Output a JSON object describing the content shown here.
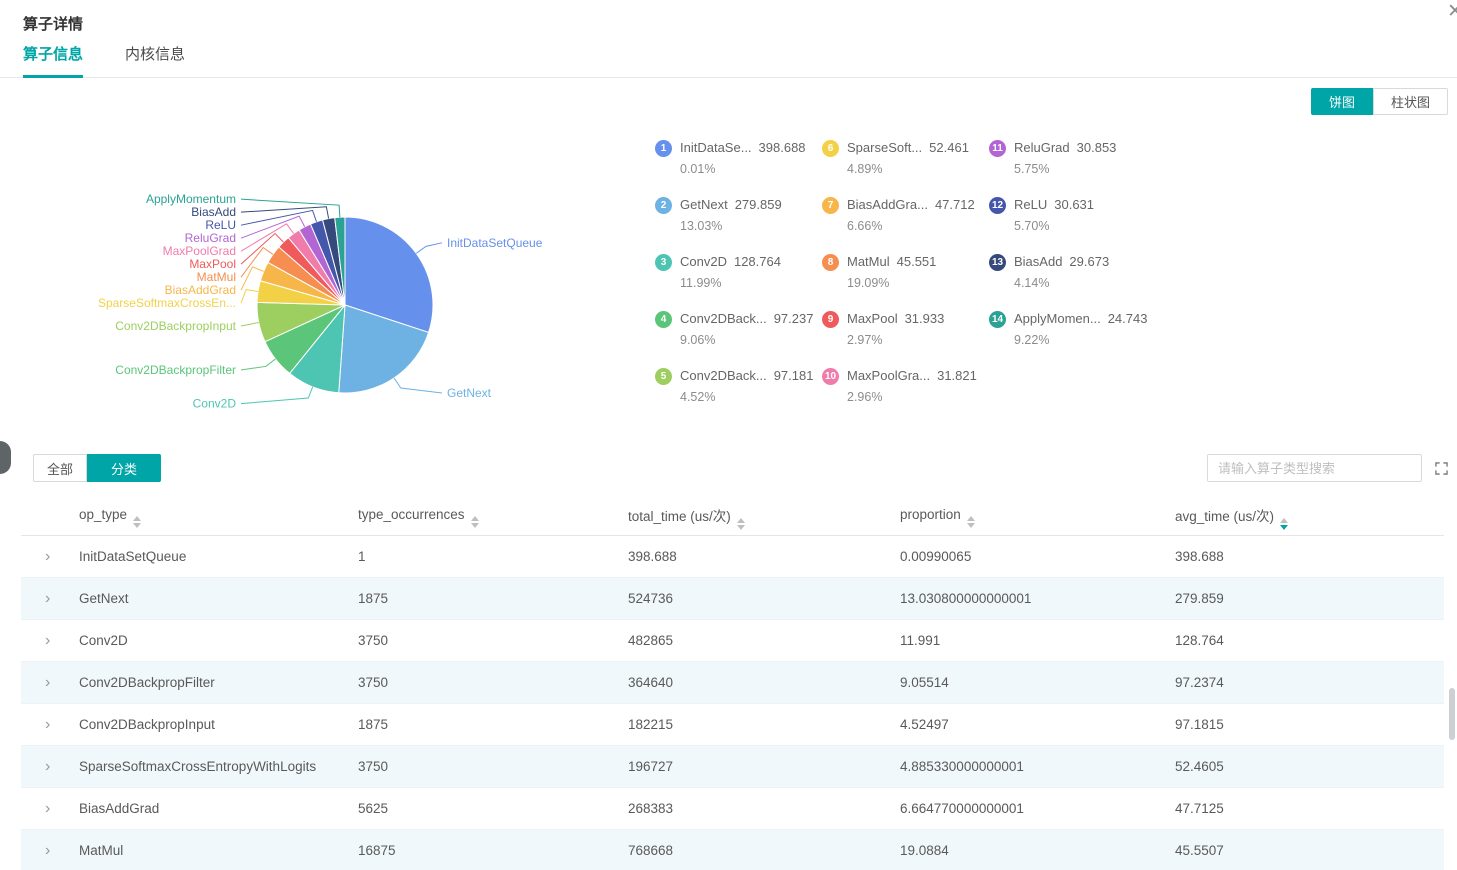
{
  "colors": {
    "accent": "#00a5a7",
    "table_alt_row": "#f1f8fb"
  },
  "header": {
    "title": "算子详情",
    "close_label": "✕"
  },
  "tabs": [
    {
      "label": "算子信息",
      "active": true
    },
    {
      "label": "内核信息",
      "active": false
    }
  ],
  "chart_toggle": {
    "pie": "饼图",
    "bar": "柱状图",
    "active": "饼图"
  },
  "chart_data": {
    "type": "pie",
    "value_label": "avg_time (us/次)",
    "legend_position": "right",
    "label_position": "outside",
    "series": [
      {
        "name": "InitDataSetQueue",
        "legend_label": "InitDataSe...",
        "pie_label": "InitDataSetQueue",
        "value": 398.688,
        "percent": "0.01%",
        "color": "#6590EC"
      },
      {
        "name": "GetNext",
        "legend_label": "GetNext",
        "pie_label": "GetNext",
        "value": 279.859,
        "percent": "13.03%",
        "color": "#6EB2E3"
      },
      {
        "name": "Conv2D",
        "legend_label": "Conv2D",
        "pie_label": "Conv2D",
        "value": 128.764,
        "percent": "11.99%",
        "color": "#4EC5B2"
      },
      {
        "name": "Conv2DBackpropFilter",
        "legend_label": "Conv2DBack...",
        "pie_label": "Conv2DBackpropFilter",
        "value": 97.237,
        "percent": "9.06%",
        "color": "#5BC579"
      },
      {
        "name": "Conv2DBackpropInput",
        "legend_label": "Conv2DBack...",
        "pie_label": "Conv2DBackpropInput",
        "value": 97.181,
        "percent": "4.52%",
        "color": "#9CCF5F"
      },
      {
        "name": "SparseSoftmaxCrossEntropyWithLogits",
        "legend_label": "SparseSoft...",
        "pie_label": "SparseSoftmaxCrossEn...",
        "value": 52.461,
        "percent": "4.89%",
        "color": "#F2D147"
      },
      {
        "name": "BiasAddGrad",
        "legend_label": "BiasAddGra...",
        "pie_label": "BiasAddGrad",
        "value": 47.712,
        "percent": "6.66%",
        "color": "#F7B64A"
      },
      {
        "name": "MatMul",
        "legend_label": "MatMul",
        "pie_label": "MatMul",
        "value": 45.551,
        "percent": "19.09%",
        "color": "#F58E50"
      },
      {
        "name": "MaxPool",
        "legend_label": "MaxPool",
        "pie_label": "MaxPool",
        "value": 31.933,
        "percent": "2.97%",
        "color": "#EF5B5C"
      },
      {
        "name": "MaxPoolGrad",
        "legend_label": "MaxPoolGra...",
        "pie_label": "MaxPoolGrad",
        "value": 31.821,
        "percent": "2.96%",
        "color": "#F07CAB"
      },
      {
        "name": "ReluGrad",
        "legend_label": "ReluGrad",
        "pie_label": "ReluGrad",
        "value": 30.853,
        "percent": "5.75%",
        "color": "#B266D3"
      },
      {
        "name": "ReLU",
        "legend_label": "ReLU",
        "pie_label": "ReLU",
        "value": 30.631,
        "percent": "5.70%",
        "color": "#4557AB"
      },
      {
        "name": "BiasAdd",
        "legend_label": "BiasAdd",
        "pie_label": "BiasAdd",
        "value": 29.673,
        "percent": "4.14%",
        "color": "#35497C"
      },
      {
        "name": "ApplyMomentum",
        "legend_label": "ApplyMomen...",
        "pie_label": "ApplyMomentum",
        "value": 24.743,
        "percent": "9.22%",
        "color": "#2BA294"
      }
    ]
  },
  "filter": {
    "all": "全部",
    "category": "分类",
    "active": "分类",
    "search_placeholder": "请输入算子类型搜索"
  },
  "table": {
    "columns": [
      {
        "key": "op_type",
        "label": "op_type",
        "sort": "none"
      },
      {
        "key": "type_occurrences",
        "label": "type_occurrences",
        "sort": "none"
      },
      {
        "key": "total_time",
        "label": "total_time (us/次)",
        "sort": "none"
      },
      {
        "key": "proportion",
        "label": "proportion",
        "sort": "none"
      },
      {
        "key": "avg_time",
        "label": "avg_time (us/次)",
        "sort": "desc"
      }
    ],
    "rows": [
      {
        "op_type": "InitDataSetQueue",
        "type_occurrences": "1",
        "total_time": "398.688",
        "proportion": "0.00990065",
        "avg_time": "398.688"
      },
      {
        "op_type": "GetNext",
        "type_occurrences": "1875",
        "total_time": "524736",
        "proportion": "13.030800000000001",
        "avg_time": "279.859"
      },
      {
        "op_type": "Conv2D",
        "type_occurrences": "3750",
        "total_time": "482865",
        "proportion": "11.991",
        "avg_time": "128.764"
      },
      {
        "op_type": "Conv2DBackpropFilter",
        "type_occurrences": "3750",
        "total_time": "364640",
        "proportion": "9.05514",
        "avg_time": "97.2374"
      },
      {
        "op_type": "Conv2DBackpropInput",
        "type_occurrences": "1875",
        "total_time": "182215",
        "proportion": "4.52497",
        "avg_time": "97.1815"
      },
      {
        "op_type": "SparseSoftmaxCrossEntropyWithLogits",
        "type_occurrences": "3750",
        "total_time": "196727",
        "proportion": "4.885330000000001",
        "avg_time": "52.4605"
      },
      {
        "op_type": "BiasAddGrad",
        "type_occurrences": "5625",
        "total_time": "268383",
        "proportion": "6.664770000000001",
        "avg_time": "47.7125"
      },
      {
        "op_type": "MatMul",
        "type_occurrences": "16875",
        "total_time": "768668",
        "proportion": "19.0884",
        "avg_time": "45.5507"
      }
    ]
  }
}
